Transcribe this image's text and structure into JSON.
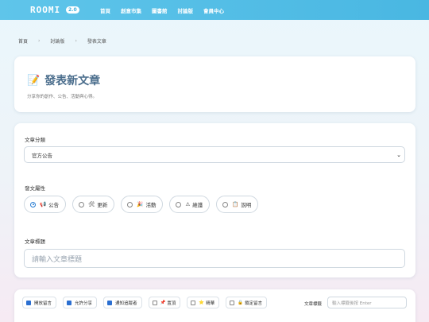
{
  "app": {
    "logo": "ROOMI",
    "logo_badge": "2.0"
  },
  "nav": [
    "首頁",
    "創意市集",
    "圖書館",
    "討論版",
    "會員中心"
  ],
  "breadcrumb": [
    "首頁",
    "討論版",
    "發表文章"
  ],
  "header": {
    "icon": "📝",
    "title": "發表新文章",
    "subtitle": "分享你的創作、公告、活動與心得。"
  },
  "form": {
    "category_label": "文章分類",
    "category_value": "官方公告",
    "attr_label": "發文屬性",
    "attributes": [
      {
        "icon": "📢",
        "label": "公告",
        "selected": true
      },
      {
        "icon": "🛠",
        "label": "更新",
        "selected": false
      },
      {
        "icon": "🎉",
        "label": "活動",
        "selected": false
      },
      {
        "icon": "⚠",
        "label": "維護",
        "selected": false
      },
      {
        "icon": "📋",
        "label": "說明",
        "selected": false
      }
    ],
    "title_label": "文章標題",
    "title_placeholder": "請輸入文章標題"
  },
  "options": {
    "items": [
      {
        "icon": "",
        "label": "開放留言",
        "checked": true
      },
      {
        "icon": "",
        "label": "允許分享",
        "checked": true
      },
      {
        "icon": "",
        "label": "通知追蹤者",
        "checked": true
      },
      {
        "icon": "📌",
        "label": "置頂",
        "checked": false
      },
      {
        "icon": "⭐",
        "label": "精華",
        "checked": false
      },
      {
        "icon": "🔒",
        "label": "鎖定留言",
        "checked": false
      }
    ],
    "tag_label": "文章標籤",
    "tag_placeholder": "輸入標籤後按 Enter"
  },
  "colors": {
    "topbar": "#49b7e2",
    "title": "#4a6d8c",
    "accent": "#2b6fd1"
  }
}
